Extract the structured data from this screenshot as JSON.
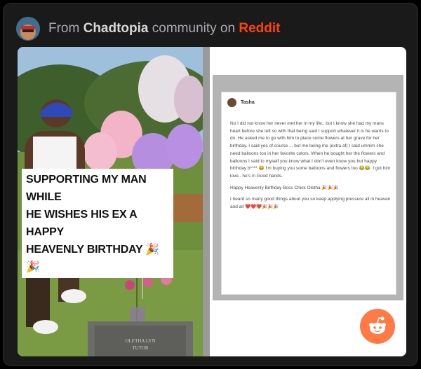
{
  "header": {
    "prefix": "From",
    "community": "Chadtopia",
    "middle": "community on",
    "platform": "Reddit"
  },
  "photo": {
    "caption_lines": [
      "SUPPORTING MY MAN WHILE",
      "HE WISHES HIS EX A HAPPY",
      "HEAVENLY  BIRTHDAY 🎉🎉"
    ],
    "headstone_text": [
      "OLETHA LYN",
      "TUTOR"
    ]
  },
  "fb_post": {
    "author": "Tasha",
    "paragraphs": [
      "No I did not know her never met her in my life.. but I know she had my mans heart before she left so with that being said I support whatever it is he wants to do. He asked me to go with him to place some flowers at her grave for her birthday.  I said yes of course ... but me being me (extra af) I said ummm she need balloons too in her favorite colors. When he bought her the flowers and balloons I said to myself you know what I don't even know you but happy birthday b**** 😂 I'm buying you some balloons and flowers too 😂😂. I got him love.. he's in Good hands.",
      "Happy Heavenly Birthday Boss Chick Oletha 🎉🎉🎉",
      "I heard so many good things about you so keep applying pressure all in heaven and all ❤️❤️❤️🎉🎉🎉"
    ]
  },
  "colors": {
    "card_bg": "#1a1a1b",
    "reddit_orange": "#ff4500",
    "reddit_button": "#ff7a45"
  }
}
